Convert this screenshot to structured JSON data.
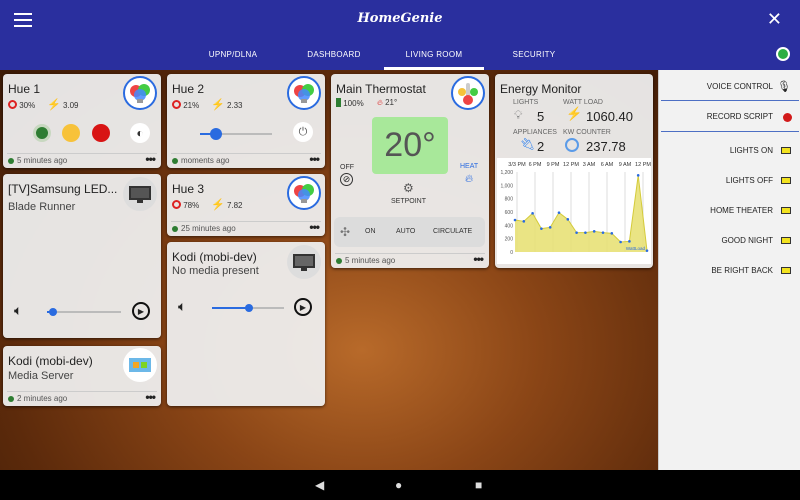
{
  "app": {
    "title": "HomeGenie"
  },
  "tabs": [
    {
      "label": "UPNP/DLNA"
    },
    {
      "label": "DASHBOARD"
    },
    {
      "label": "LIVING ROOM"
    },
    {
      "label": "SECURITY"
    }
  ],
  "active_tab": "LIVING ROOM",
  "hue1": {
    "title": "Hue 1",
    "level": "30%",
    "watt": "3.09",
    "footer": "5 minutes ago"
  },
  "hue2": {
    "title": "Hue 2",
    "level": "21%",
    "watt": "2.33",
    "footer": "moments ago",
    "slider_value": 0.22
  },
  "hue3": {
    "title": "Hue 3",
    "level": "78%",
    "watt": "7.82",
    "footer": "25 minutes ago"
  },
  "tv": {
    "title": "[TV]Samsung LED...",
    "subtitle": "Blade Runner",
    "volume": 0.08
  },
  "kodi_server": {
    "title": "Kodi (mobi-dev)",
    "subtitle": "Media Server",
    "footer": "2 minutes ago"
  },
  "kodi_player": {
    "title": "Kodi (mobi-dev)",
    "subtitle": "No media present",
    "volume": 0.52
  },
  "thermostat": {
    "title": "Main Thermostat",
    "battery": "100%",
    "temp": "21°",
    "setpoint": "20°",
    "setpoint_label": "SETPOINT",
    "off_label": "OFF",
    "heat_label": "HEAT",
    "fan_modes": [
      "ON",
      "AUTO",
      "CIRCULATE"
    ],
    "footer": "5 minutes ago"
  },
  "energy": {
    "title": "Energy Monitor",
    "lights_label": "LIGHTS",
    "lights_value": "5",
    "watt_label": "WATT LOAD",
    "watt_value": "1060.40",
    "appliances_label": "APPLIANCES",
    "appliances_value": "2",
    "kw_label": "KW COUNTER",
    "kw_value": "237.78"
  },
  "chart_data": {
    "type": "area",
    "x_tick_labels": [
      "3/3 PM",
      "6 PM",
      "9 PM",
      "12 PM",
      "3 AM",
      "6 AM",
      "9 AM",
      "12 PM"
    ],
    "y_tick_labels": [
      "1,200",
      "1,000",
      "800",
      "600",
      "400",
      "200",
      "0"
    ],
    "ylim": [
      0,
      1200
    ],
    "values": [
      480,
      460,
      580,
      350,
      370,
      590,
      490,
      290,
      290,
      310,
      290,
      280,
      150,
      160,
      1150,
      20
    ],
    "legend": "WattLoad",
    "colors": {
      "fill": "#e6df6e",
      "line": "#d4cb3a",
      "point": "#2a6be0"
    }
  },
  "panel": {
    "voice_control": "VOICE CONTROL",
    "record_script": "RECORD SCRIPT",
    "scenes": [
      "LIGHTS ON",
      "LIGHTS OFF",
      "HOME THEATER",
      "GOOD NIGHT",
      "BE RIGHT BACK"
    ]
  },
  "colors": {
    "appbar": "#2a2f9e",
    "accent": "#2a6be0",
    "setpoint_bg": "#a8e89a"
  }
}
